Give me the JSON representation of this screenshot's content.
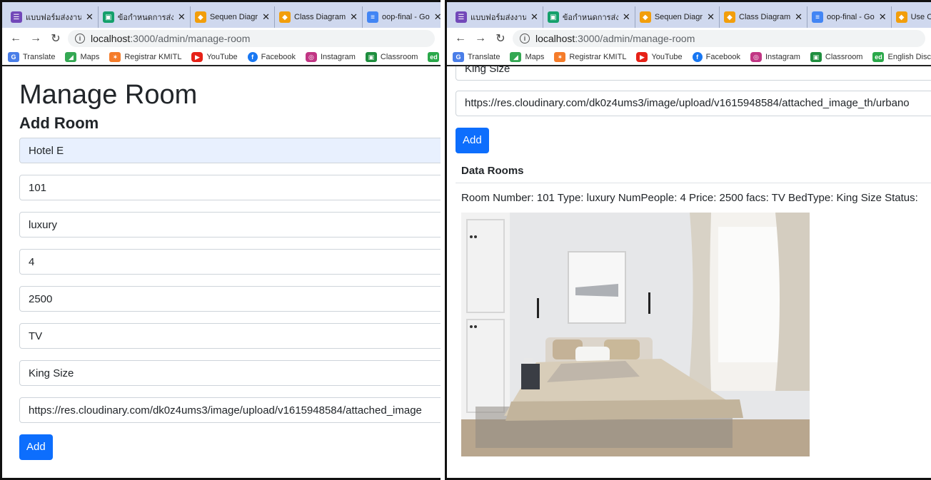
{
  "left_window": {
    "tabs": [
      {
        "label": "แบบฟอร์มส่งงาน",
        "icon": "forms-icon"
      },
      {
        "label": "ข้อกำหนดการส่ง",
        "icon": "classroom-icon"
      },
      {
        "label": "Sequen Diagr",
        "icon": "draw-icon"
      },
      {
        "label": "Class Diagram",
        "icon": "draw-icon"
      },
      {
        "label": "oop-final - Go",
        "icon": "docs-icon"
      }
    ],
    "tab_close": "✕",
    "url_host": "localhost",
    "url_rest": ":3000/admin/manage-room",
    "bookmarks": [
      {
        "label": "Translate",
        "icon": "translate-icon"
      },
      {
        "label": "Maps",
        "icon": "maps-icon"
      },
      {
        "label": "Registrar KMITL",
        "icon": "registrar-icon"
      },
      {
        "label": "YouTube",
        "icon": "youtube-icon"
      },
      {
        "label": "Facebook",
        "icon": "facebook-icon"
      },
      {
        "label": "Instagram",
        "icon": "instagram-icon"
      },
      {
        "label": "Classroom",
        "icon": "classroom-icon"
      },
      {
        "label": "ed",
        "icon": "ed-icon"
      }
    ],
    "page_title": "Manage Room",
    "section_title": "Add Room",
    "fields": {
      "hotel": "Hotel E",
      "room_number": "101",
      "type": "luxury",
      "num_people": "4",
      "price": "2500",
      "facilities": "TV",
      "bed_type": "King Size",
      "image_url": "https://res.cloudinary.com/dk0z4ums3/image/upload/v1615948584/attached_image"
    },
    "add_label": "Add"
  },
  "right_window": {
    "tabs": [
      {
        "label": "แบบฟอร์มส่งงาน",
        "icon": "forms-icon"
      },
      {
        "label": "ข้อกำหนดการส่ง",
        "icon": "classroom-icon"
      },
      {
        "label": "Sequen Diagr",
        "icon": "draw-icon"
      },
      {
        "label": "Class Diagram",
        "icon": "draw-icon"
      },
      {
        "label": "oop-final - Go",
        "icon": "docs-icon"
      },
      {
        "label": "Use C",
        "icon": "draw-icon"
      }
    ],
    "url_host": "localhost",
    "url_rest": ":3000/admin/manage-room",
    "bookmarks": [
      {
        "label": "Translate"
      },
      {
        "label": "Maps"
      },
      {
        "label": "Registrar KMITL"
      },
      {
        "label": "YouTube"
      },
      {
        "label": "Facebook"
      },
      {
        "label": "Instagram"
      },
      {
        "label": "Classroom"
      },
      {
        "label": "English Discover"
      }
    ],
    "bed_type_field": "King Size",
    "image_url_field": "https://res.cloudinary.com/dk0z4ums3/image/upload/v1615948584/attached_image_th/urbano",
    "add_label": "Add",
    "data_rooms_title": "Data Rooms",
    "room_line": "Room Number: 101 Type: luxury NumPeople: 4 Price: 2500 facs: TV BedType: King Size Status:"
  },
  "colors": {
    "primary": "#0d6efd",
    "tabbar": "#cfd8ee",
    "autofill": "#e8f0fe"
  }
}
